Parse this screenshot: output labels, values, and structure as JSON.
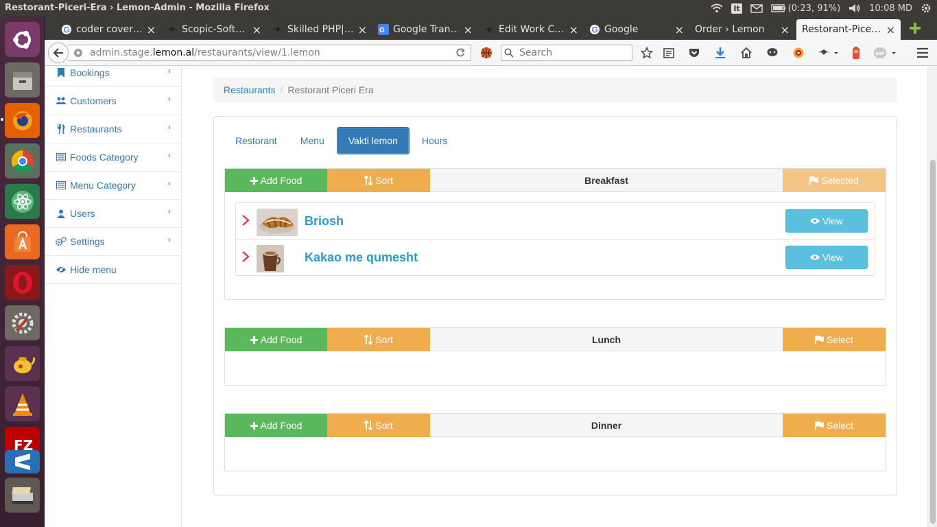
{
  "os": {
    "window_title": "Restorant-Piceri-Era › Lemon-Admin - Mozilla Firefox",
    "keyboard_layout": "It",
    "battery": "(0:23, 91%)",
    "clock": "10:08 MD"
  },
  "launcher": {
    "items": [
      "ubuntu-dash",
      "files",
      "firefox",
      "chrome",
      "atom",
      "software-center",
      "opera",
      "system-settings",
      "teapot",
      "vlc",
      "filezilla",
      "sublime",
      "scanner"
    ]
  },
  "browser": {
    "tabs": [
      {
        "label": "coder cover…",
        "favicon": "google-icon"
      },
      {
        "label": "Scopic-Soft…",
        "favicon": "ninja-icon"
      },
      {
        "label": "Skilled PHP|…",
        "favicon": "ninja-icon"
      },
      {
        "label": "Google Tran…",
        "favicon": "translate-icon"
      },
      {
        "label": "Edit Work C…",
        "favicon": "ninja-icon"
      },
      {
        "label": "Google",
        "favicon": "google-icon"
      },
      {
        "label": "Order › Lemon",
        "favicon": ""
      },
      {
        "label": "Restorant-Pice…",
        "favicon": "",
        "active": true
      }
    ],
    "url_prefix": "admin.stage.",
    "url_domain": "lemon.al",
    "url_path": "/restaurants/view/1.lemon",
    "search_placeholder": "Search"
  },
  "sidebar": {
    "items": [
      {
        "label": "Bookings",
        "icon": "bookmark-icon"
      },
      {
        "label": "Customers",
        "icon": "users-icon"
      },
      {
        "label": "Restaurants",
        "icon": "cutlery-icon"
      },
      {
        "label": "Foods Category",
        "icon": "list-icon"
      },
      {
        "label": "Menu Category",
        "icon": "list-icon"
      },
      {
        "label": "Users",
        "icon": "user-icon"
      },
      {
        "label": "Settings",
        "icon": "gears-icon"
      },
      {
        "label": "Hide menu",
        "icon": "eye-slash-icon"
      }
    ]
  },
  "breadcrumb": {
    "link": "Restaurants",
    "current": "Restorant Piceri Era"
  },
  "tabs": [
    {
      "label": "Restorant"
    },
    {
      "label": "Menu"
    },
    {
      "label": "Vakti lemon",
      "active": true
    },
    {
      "label": "Hours"
    }
  ],
  "meals": [
    {
      "title": "Breakfast",
      "add_label": "Add Food",
      "sort_label": "Sort",
      "select_label": "Selected",
      "selected": true,
      "foods": [
        {
          "name": "Briosh",
          "view_label": "View"
        },
        {
          "name": "Kakao me qumesht",
          "view_label": "View"
        }
      ]
    },
    {
      "title": "Lunch",
      "add_label": "Add Food",
      "sort_label": "Sort",
      "select_label": "Select",
      "selected": false,
      "foods": []
    },
    {
      "title": "Dinner",
      "add_label": "Add Food",
      "sort_label": "Sort",
      "select_label": "Select",
      "selected": false,
      "foods": []
    }
  ],
  "colors": {
    "primary": "#337ab7",
    "success": "#5cb85c",
    "warning": "#f0ad4e",
    "info": "#5bc0de",
    "launcher": "#4a2a3f"
  }
}
